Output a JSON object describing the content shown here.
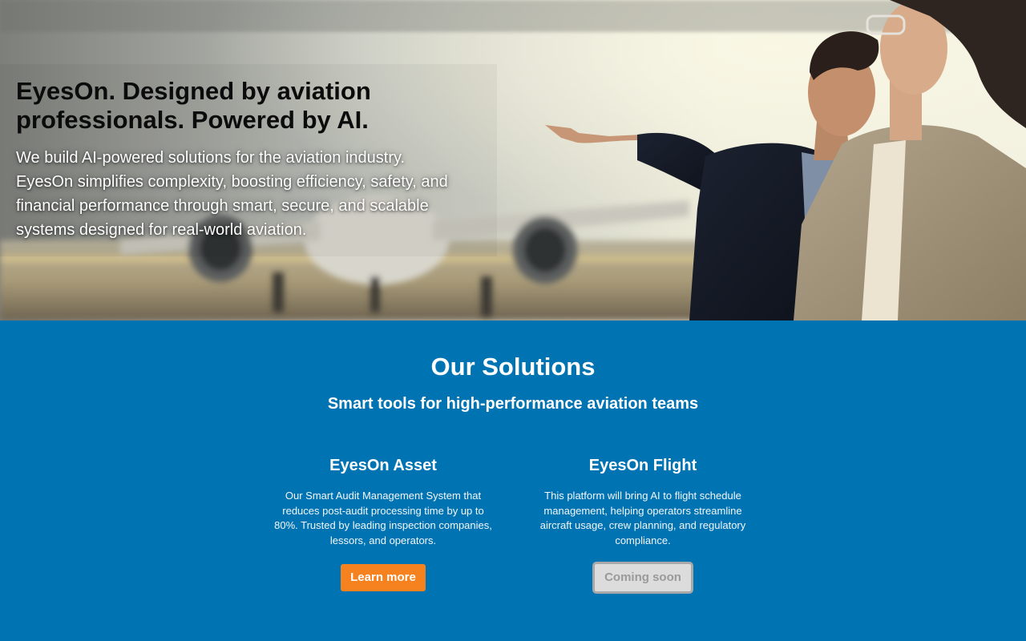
{
  "hero": {
    "title": "EyesOn. Designed by aviation professionals. Powered by AI.",
    "description": "We build AI-powered solutions for the aviation industry. EyesOn simplifies complexity, boosting efficiency, safety, and financial performance through smart, secure, and scalable systems designed for real-world aviation."
  },
  "solutions": {
    "title": "Our Solutions",
    "subtitle": "Smart tools for high-performance aviation teams",
    "cards": [
      {
        "title": "EyesOn Asset",
        "description": "Our Smart Audit Management System that reduces post-audit processing time by up to 80%. Trusted by leading inspection companies, lessors, and operators.",
        "button_label": "Learn more"
      },
      {
        "title": "EyesOn Flight",
        "description": "This platform will bring AI to flight schedule management, helping operators streamline aircraft usage, crew planning, and regulatory compliance.",
        "button_label": "Coming soon"
      }
    ]
  },
  "colors": {
    "section_background": "#0074b3",
    "primary_button": "#f5821f",
    "disabled_button": "#dcdcdc",
    "hero_title": "#0b0b0b"
  }
}
